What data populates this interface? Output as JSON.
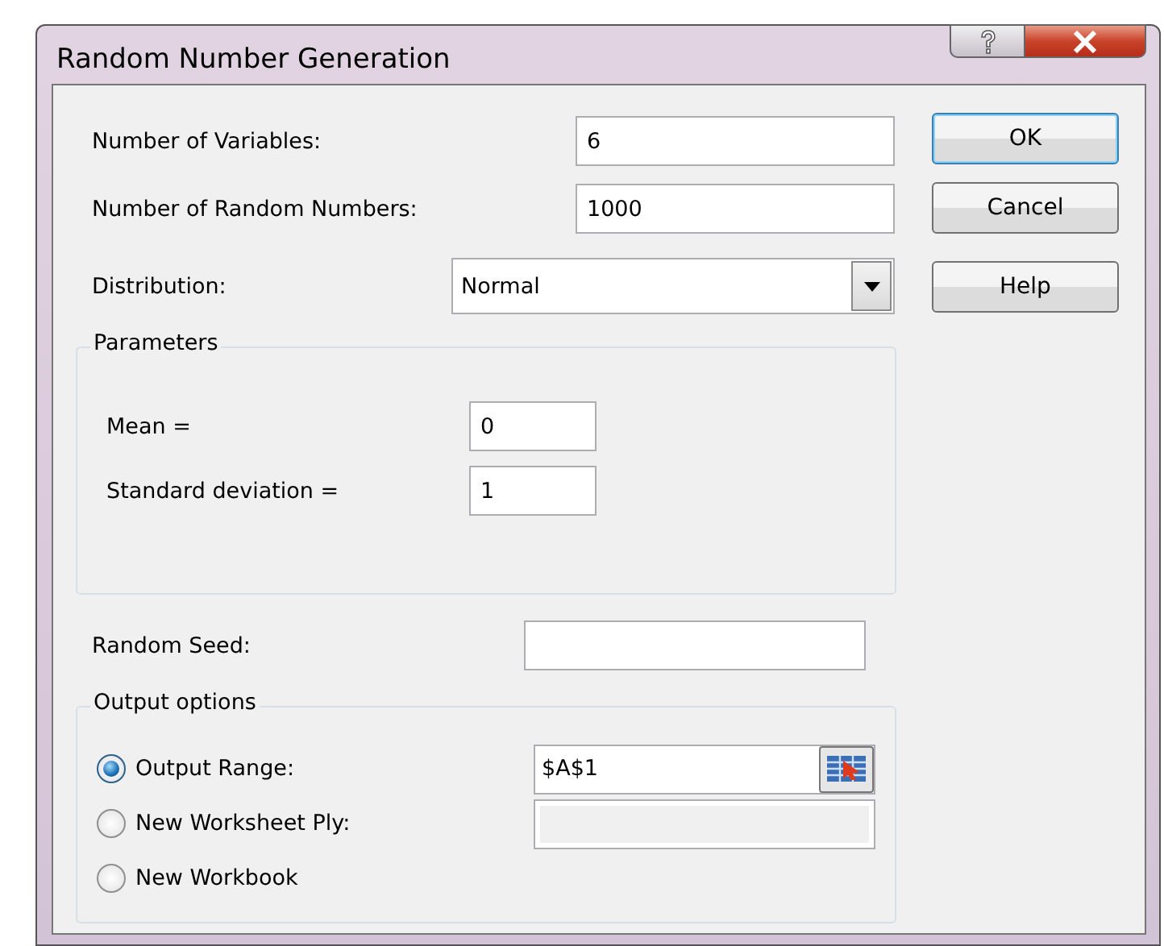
{
  "window": {
    "title": "Random Number Generation"
  },
  "fields": [
    {
      "label": "Number of Variables:",
      "value": "6"
    },
    {
      "label": "Number of Random Numbers:",
      "value": "1000"
    }
  ],
  "distribution": {
    "label": "Distribution:",
    "value": "Normal"
  },
  "parameters": {
    "title": "Parameters",
    "fields": [
      {
        "label": "Mean =",
        "value": "0"
      },
      {
        "label": "Standard deviation =",
        "value": "1"
      }
    ]
  },
  "random_seed": {
    "label": "Random Seed:"
  },
  "output_options": {
    "title": "Output options",
    "options": [
      {
        "label": "Output Range:",
        "selected": true,
        "kind": "range",
        "value": "$A$1",
        "disabled": false
      },
      {
        "label": "New Worksheet Ply:",
        "selected": false,
        "kind": "text",
        "disabled": true
      },
      {
        "label": "New Workbook",
        "selected": false,
        "kind": "none"
      }
    ]
  },
  "buttons": [
    {
      "label": "OK",
      "focused": true
    },
    {
      "label": "Cancel",
      "focused": false
    },
    {
      "label": "Help",
      "focused": false
    }
  ]
}
